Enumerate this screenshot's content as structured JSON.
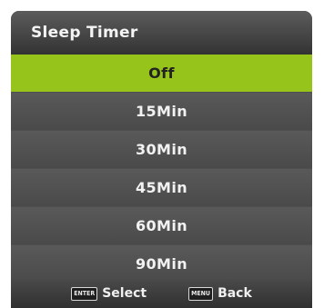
{
  "header": {
    "title": "Sleep Timer"
  },
  "options": [
    {
      "label": "Off",
      "selected": true
    },
    {
      "label": "15Min",
      "selected": false
    },
    {
      "label": "30Min",
      "selected": false
    },
    {
      "label": "45Min",
      "selected": false
    },
    {
      "label": "60Min",
      "selected": false
    },
    {
      "label": "90Min",
      "selected": false
    }
  ],
  "footer": {
    "select": {
      "key_icon": "ENTER",
      "label": "Select"
    },
    "back": {
      "key_icon": "MENU",
      "label": "Back"
    }
  },
  "colors": {
    "highlight": "#96c41b",
    "panel": "#4f4f4f"
  }
}
